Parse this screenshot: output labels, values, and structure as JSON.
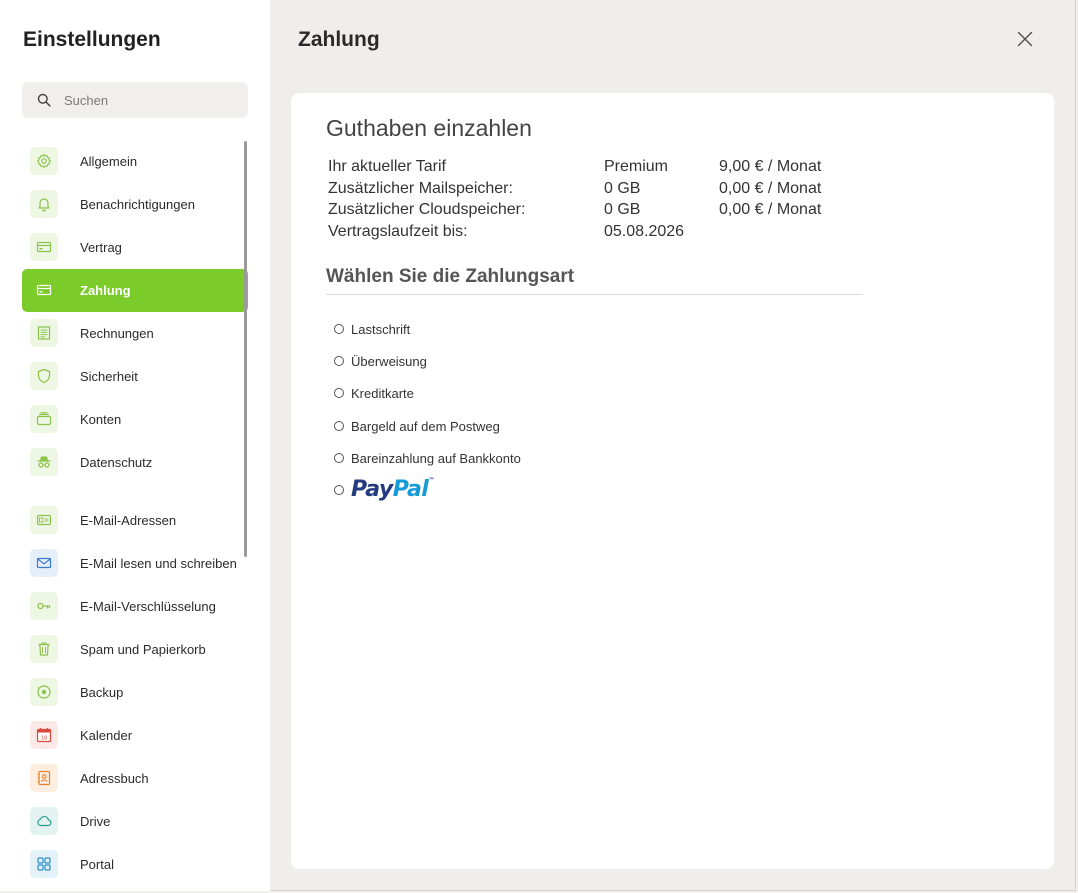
{
  "sidebar": {
    "title": "Einstellungen",
    "search_placeholder": "Suchen",
    "items": [
      {
        "label": "Allgemein",
        "icon": "gear-icon"
      },
      {
        "label": "Benachrichtigungen",
        "icon": "bell-icon"
      },
      {
        "label": "Vertrag",
        "icon": "card-icon"
      },
      {
        "label": "Zahlung",
        "icon": "card-icon",
        "active": true
      },
      {
        "label": "Rechnungen",
        "icon": "invoice-icon"
      },
      {
        "label": "Sicherheit",
        "icon": "shield-icon"
      },
      {
        "label": "Konten",
        "icon": "accounts-icon"
      },
      {
        "label": "Datenschutz",
        "icon": "incognito-icon"
      },
      {
        "label": "E-Mail-Adressen",
        "icon": "address-card-icon"
      },
      {
        "label": "E-Mail lesen und schreiben",
        "icon": "envelope-icon"
      },
      {
        "label": "E-Mail-Verschlüsselung",
        "icon": "key-icon"
      },
      {
        "label": "Spam und Papierkorb",
        "icon": "trash-icon"
      },
      {
        "label": "Backup",
        "icon": "backup-icon"
      },
      {
        "label": "Kalender",
        "icon": "calendar-icon",
        "day": "18"
      },
      {
        "label": "Adressbuch",
        "icon": "contact-book-icon"
      },
      {
        "label": "Drive",
        "icon": "cloud-icon"
      },
      {
        "label": "Portal",
        "icon": "grid-icon"
      }
    ]
  },
  "main": {
    "title": "Zahlung",
    "section_title": "Guthaben einzahlen",
    "tariff_rows": [
      {
        "label": "Ihr aktueller Tarif",
        "value": "Premium",
        "price": "9,00 € / Monat"
      },
      {
        "label": "Zusätzlicher Mailspeicher:",
        "value": "0 GB",
        "price": "0,00 € / Monat"
      },
      {
        "label": "Zusätzlicher Cloudspeicher:",
        "value": "0 GB",
        "price": "0,00 € / Monat"
      },
      {
        "label": "Vertragslaufzeit bis:",
        "value": "05.08.2026",
        "price": ""
      }
    ],
    "payment_title": "Wählen Sie die Zahlungsart",
    "payment_options": [
      "Lastschrift",
      "Überweisung",
      "Kreditkarte",
      "Bargeld auf dem Postweg",
      "Bareinzahlung auf Bankkonto"
    ],
    "paypal": {
      "pay": "Pay",
      "pal": "Pal",
      "tm": "™"
    }
  },
  "colors": {
    "accent": "#7bcc2a",
    "icon_green": "#8bc34a",
    "paypal_dark": "#253b80",
    "paypal_light": "#179bd7"
  }
}
